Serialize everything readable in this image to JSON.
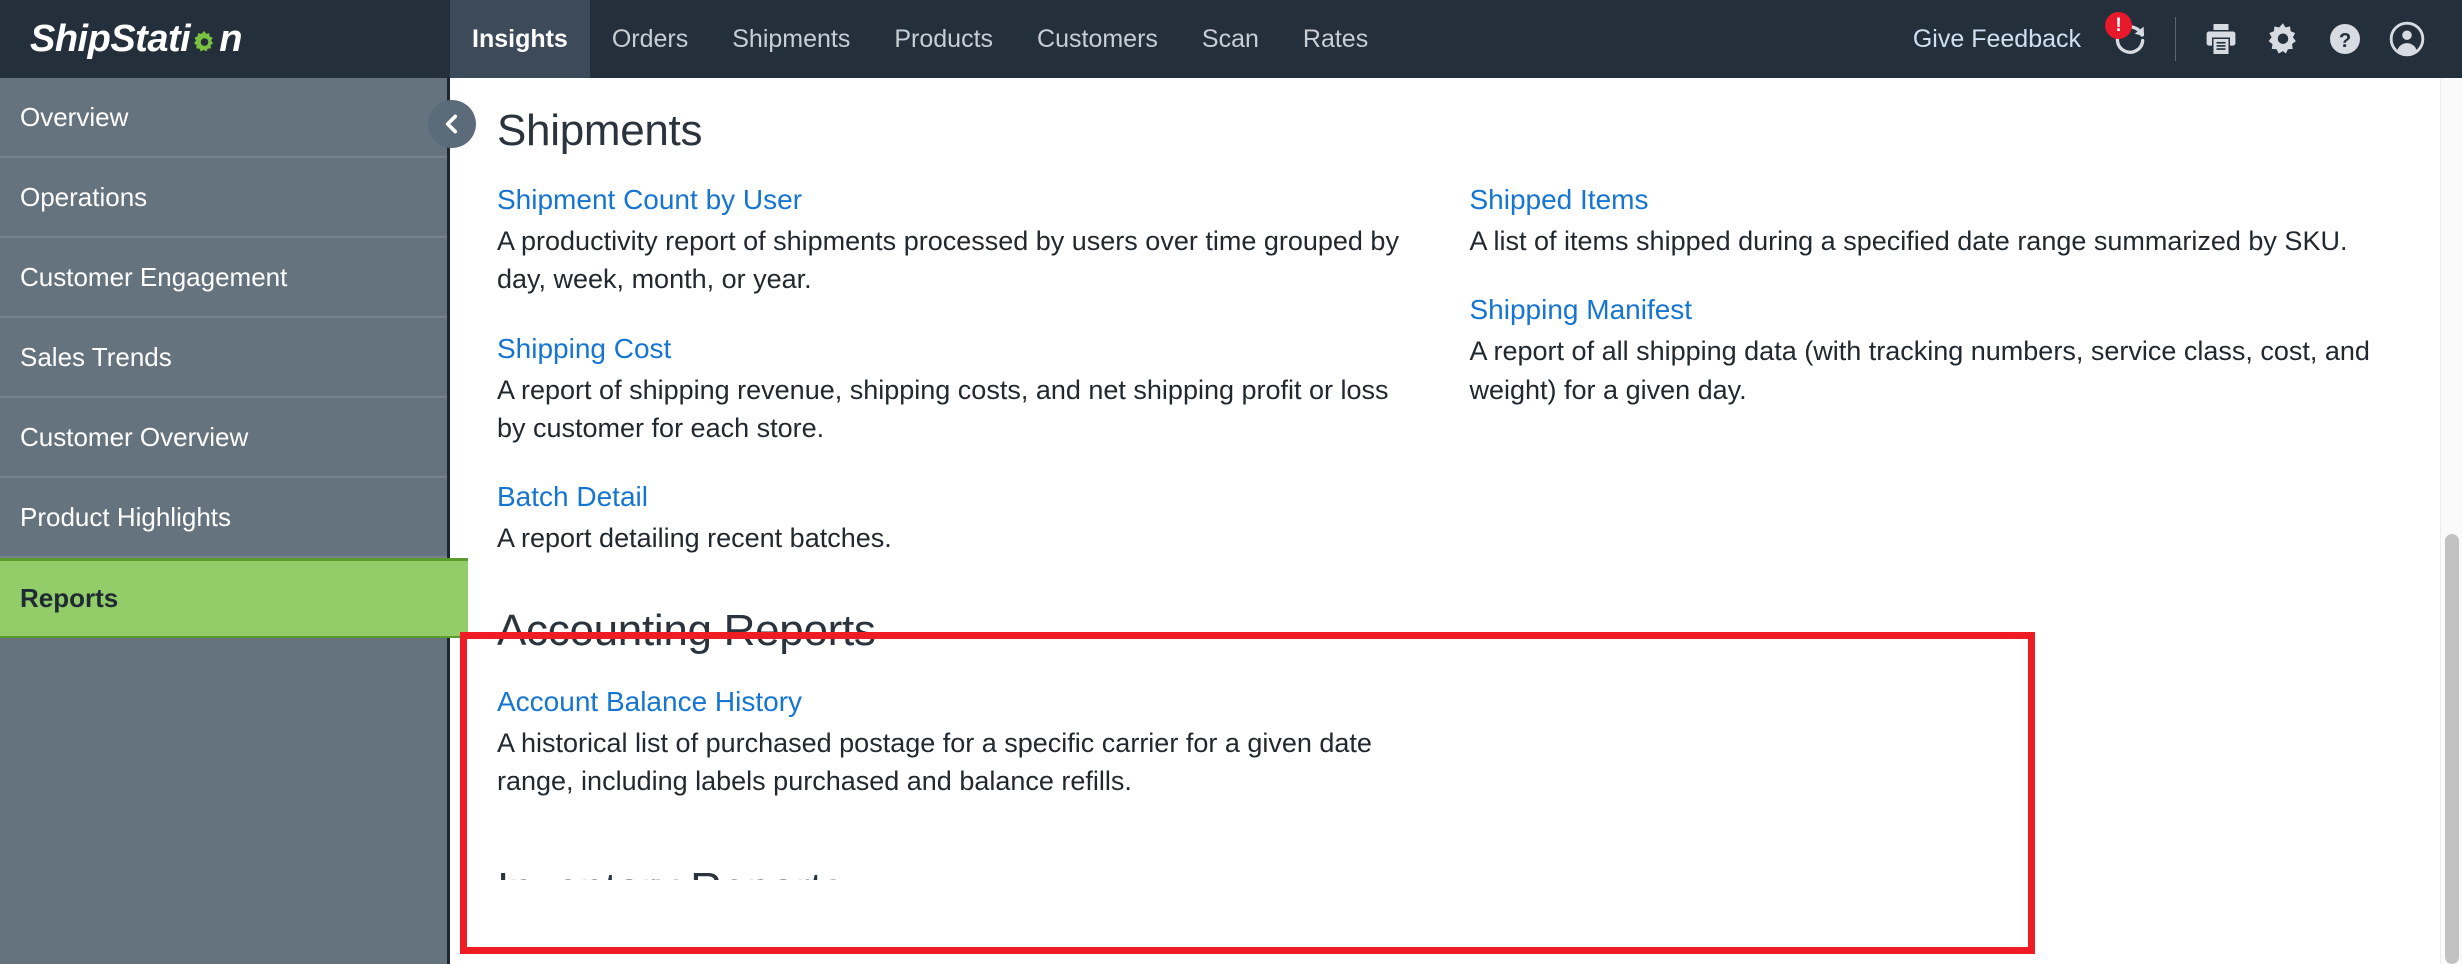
{
  "header": {
    "brand_before": "ShipStati",
    "brand_gear_icon": "gear-icon",
    "brand_after": "n",
    "nav_tabs": [
      {
        "label": "Insights",
        "active": true
      },
      {
        "label": "Orders",
        "active": false
      },
      {
        "label": "Shipments",
        "active": false
      },
      {
        "label": "Products",
        "active": false
      },
      {
        "label": "Customers",
        "active": false
      },
      {
        "label": "Scan",
        "active": false
      },
      {
        "label": "Rates",
        "active": false
      }
    ],
    "feedback_label": "Give Feedback",
    "refresh_icon": "refresh-icon",
    "refresh_badge": "!",
    "print_icon": "printer-icon",
    "settings_icon": "gear-icon",
    "help_icon": "help-icon",
    "account_icon": "user-avatar-icon"
  },
  "sidebar": {
    "collapse_icon": "chevron-left-icon",
    "items": [
      {
        "label": "Overview",
        "active": false
      },
      {
        "label": "Operations",
        "active": false
      },
      {
        "label": "Customer Engagement",
        "active": false
      },
      {
        "label": "Sales Trends",
        "active": false
      },
      {
        "label": "Customer Overview",
        "active": false
      },
      {
        "label": "Product Highlights",
        "active": false
      },
      {
        "label": "Reports",
        "active": true
      }
    ]
  },
  "main": {
    "shipments_section": {
      "title": "Shipments",
      "left_column": [
        {
          "link": "Shipment Count by User",
          "description": "A productivity report of shipments processed by users over time grouped by day, week, month, or year."
        },
        {
          "link": "Shipping Cost",
          "description": "A report of shipping revenue, shipping costs, and net shipping profit or loss by customer for each store."
        },
        {
          "link": "Batch Detail",
          "description": "A report detailing recent batches."
        }
      ],
      "right_column": [
        {
          "link": "Shipped Items",
          "description": "A list of items shipped during a specified date range summarized by SKU."
        },
        {
          "link": "Shipping Manifest",
          "description": "A report of all shipping data (with tracking numbers, service class, cost, and weight) for a given day."
        }
      ]
    },
    "accounting_section": {
      "title": "Accounting Reports",
      "left_column": [
        {
          "link": "Account Balance History",
          "description": "A historical list of purchased postage for a specific carrier for a given date range, including labels purchased and balance refills."
        }
      ]
    },
    "next_section_clipped_title": "Inventory Reports"
  },
  "annotation": {
    "box_color": "#f01c24"
  },
  "colors": {
    "header_bg": "#242f3c",
    "active_tab_bg": "#3d4a59",
    "sidebar_bg": "#65737f",
    "sidebar_active_bg": "#93cd6a",
    "link_blue": "#1575d1",
    "badge_red": "#e8192c"
  }
}
